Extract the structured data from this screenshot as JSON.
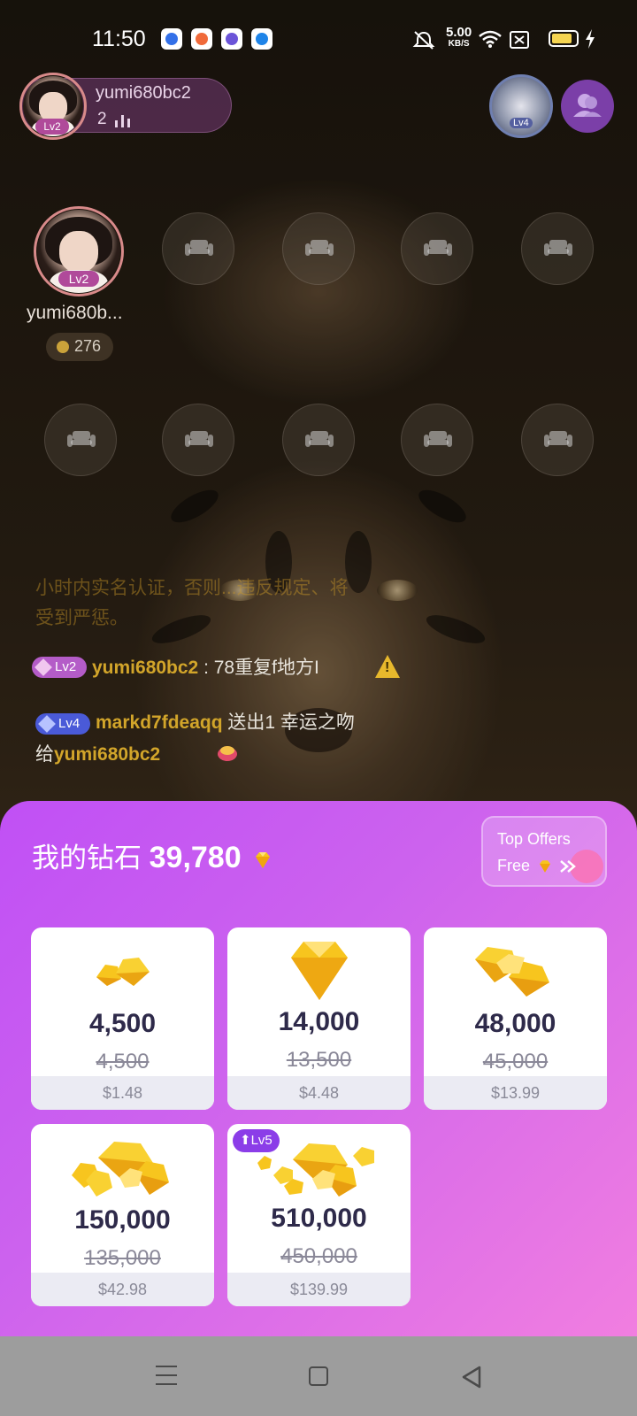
{
  "status_bar": {
    "time": "11:50",
    "net_speed_value": "5.00",
    "net_speed_unit": "KB/S",
    "battery_color": "#f5d451"
  },
  "host": {
    "name": "yumi680bc2",
    "listener_count": "2",
    "level_badge": "Lv2"
  },
  "room_emblem": {
    "level": "Lv4"
  },
  "seats": {
    "occupant_name": "yumi680b...",
    "occupant_level": "Lv2",
    "occupant_coins": "276"
  },
  "chat": {
    "faded_line_1": "小时内实名认证，否则...违反规定、将",
    "faded_line_2": "受到严惩。",
    "messages": [
      {
        "level": "Lv2",
        "user": "yumi680bc2",
        "text": " : 78重复f地方I"
      },
      {
        "level": "Lv4",
        "user": "markd7fdeaqq",
        "text": " 送出1 幸运之吻",
        "line2_prefix": "给",
        "line2_user": "yumi680bc2"
      }
    ]
  },
  "wallet": {
    "label": "我的钻石 ",
    "balance": "39,780",
    "top_offers_line1": "Top Offers",
    "top_offers_line2": "Free"
  },
  "packages": [
    {
      "amount": "4,500",
      "original": "4,500",
      "price": "$1.48",
      "gem_count": 2
    },
    {
      "amount": "14,000",
      "original": "13,500",
      "price": "$4.48",
      "gem_count": 1
    },
    {
      "amount": "48,000",
      "original": "45,000",
      "price": "$13.99",
      "gem_count": 3
    },
    {
      "amount": "150,000",
      "original": "135,000",
      "price": "$42.98",
      "gem_count": 5
    },
    {
      "amount": "510,000",
      "original": "450,000",
      "price": "$139.99",
      "gem_count": 7,
      "tag": "Lv5"
    }
  ],
  "colors": {
    "panel_start": "#c050f5",
    "panel_end": "#f17ee0",
    "gem_gold": "#f7c51e",
    "level_purple": "#8b3de8"
  },
  "icons": {
    "seat": "sofa-icon",
    "gem": "diamond-icon",
    "users": "users-icon",
    "warning": "warning-icon"
  }
}
